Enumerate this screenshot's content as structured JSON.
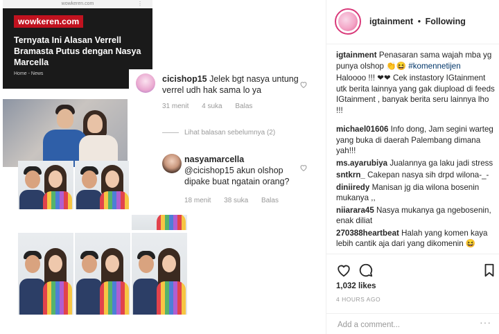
{
  "news": {
    "url": "wowkeren.com",
    "logo": "wowkeren.com",
    "headline": "Ternyata Ini Alasan Verrell Bramasta Putus dengan Nasya Marcella",
    "crumb": "Home - News"
  },
  "comments_shot": [
    {
      "user": "cicishop15",
      "text": "Jelek bgt nasya untung verrel udh hak sama lo ya",
      "time": "31 menit",
      "likes": "4 suka",
      "reply": "Balas"
    },
    {
      "user": "nasyamarcella",
      "text": "@cicishop15 akun olshop dipake buat ngatain orang?",
      "time": "18 menit",
      "likes": "38 suka",
      "reply": "Balas"
    }
  ],
  "view_previous": "Lihat balasan sebelumnya (2)",
  "post": {
    "username": "igtainment",
    "separator": "•",
    "follow_status": "Following",
    "caption_user": "igtainment",
    "caption": "Penasaran sama wajah mba yg punya olshop 👏😆 ",
    "caption_hashtag": "#komennetijen",
    "caption_extra": "Haloooo !!! ❤❤ Cek instastory IGtainment utk berita lainnya yang gak diupload di feeds IGtainment , banyak berita seru lainnya lho !!!",
    "comments": [
      {
        "user": "michael01606",
        "text": "Info dong, Jam segini warteg yang buka di daerah Palembang dimana yah!!!"
      },
      {
        "user": "ms.ayarubiya",
        "text": "Jualannya ga laku jadi stress"
      },
      {
        "user": "sntkrn_",
        "text": "Cakepan nasya sih drpd wilona-_-"
      },
      {
        "user": "diniiredy",
        "text": "Manisan jg dia wilona bosenin mukanya ,,"
      },
      {
        "user": "niiarara45",
        "text": "Nasya mukanya ga ngebosenin, enak diliat"
      },
      {
        "user": "270388heartbeat",
        "text": "Halah yang komen kaya lebih cantik aja dari yang dikomenin 😆"
      }
    ],
    "likes": "1,032 likes",
    "timestamp": "4 HOURS AGO",
    "add_comment_placeholder": "Add a comment...",
    "more": "···"
  },
  "icons": {
    "like": "heart-icon",
    "comment": "speech-bubble-icon",
    "save": "bookmark-icon"
  },
  "colors": {
    "hashtag": "#003569",
    "news_logo": "#c1121f"
  }
}
